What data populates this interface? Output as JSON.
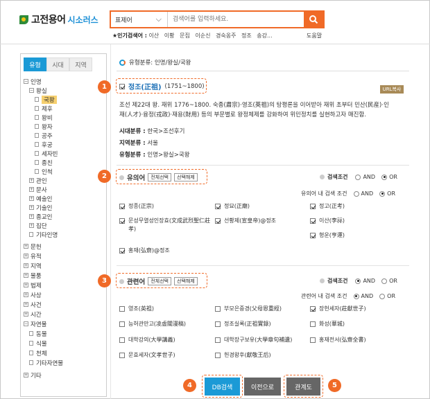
{
  "brand": {
    "name": "고전용어",
    "sub": "시소러스"
  },
  "search": {
    "select_value": "표제어",
    "placeholder": "검색어를 입력하세요."
  },
  "popular": {
    "label": "★인기검색어 :",
    "items": [
      "이산",
      "이황",
      "문집",
      "이순신",
      "경숙옹주",
      "정조",
      "송강..."
    ]
  },
  "help_label": "도움말",
  "left_tabs": [
    "유형",
    "시대",
    "지역"
  ],
  "tree": [
    {
      "label": "인명",
      "sign": "−"
    },
    {
      "label": "왕실",
      "sign": "−"
    },
    {
      "label": "국왕"
    },
    {
      "label": "제후"
    },
    {
      "label": "왕비"
    },
    {
      "label": "왕자"
    },
    {
      "label": "공주"
    },
    {
      "label": "후궁"
    },
    {
      "label": "세자빈"
    },
    {
      "label": "종친"
    },
    {
      "label": "인척"
    },
    {
      "label": "관인",
      "sign": "+"
    },
    {
      "label": "문사",
      "sign": "+"
    },
    {
      "label": "예술인",
      "sign": "+"
    },
    {
      "label": "기술인",
      "sign": "+"
    },
    {
      "label": "종교인",
      "sign": "+"
    },
    {
      "label": "집단",
      "sign": "+"
    },
    {
      "label": "기타인명"
    },
    {
      "label": "문헌",
      "sign": "+"
    },
    {
      "label": "유적",
      "sign": "+"
    },
    {
      "label": "지역",
      "sign": "+"
    },
    {
      "label": "물품",
      "sign": "+"
    },
    {
      "label": "법제",
      "sign": "+"
    },
    {
      "label": "사상",
      "sign": "+"
    },
    {
      "label": "사건",
      "sign": "+"
    },
    {
      "label": "시간",
      "sign": "+"
    },
    {
      "label": "자연물",
      "sign": "−"
    },
    {
      "label": "동물"
    },
    {
      "label": "식물"
    },
    {
      "label": "천체"
    },
    {
      "label": "기타자연물"
    },
    {
      "label": "기타",
      "sign": "+"
    }
  ],
  "breadcrumb": "유형분류: 인명/왕실/국왕",
  "entry": {
    "title": "정조(正祖)",
    "dates": "(1751~1800)",
    "url_button": "URL복사",
    "desc1": "조선 제22대 왕. 재위 1776~1800. 숙종(肅宗)·영조(英祖)의 탕평론을 이어받아 재위 초부터 민산(民産)·인",
    "desc2": "재(人才)·융정(戎政)·재용(財用) 등의 부문별로 왕정체제를 강화하여 위민정치를 실현하고자 매진함.",
    "era": "한국>조선후기",
    "region": "서울",
    "type": "인명>왕실>국왕",
    "era_label": "시대분류 :",
    "region_label": "지역분류 :",
    "type_label": "유형분류 :"
  },
  "synonyms": {
    "label": "유의어",
    "select_all": "전체선택",
    "deselect": "선택해제",
    "cond_label": "검색조건",
    "inner_cond_label": "유의어 내 검색 조건",
    "items": [
      "정종(正宗)",
      "정묘(正廟)",
      "정고(正考)",
      "문성무열성인장효(文成武烈聖仁莊孝)",
      "선황제(宣皇帝)@정조",
      "이산(李祘)",
      "형운(亨運)",
      "홍재(弘齋)@정조"
    ]
  },
  "related": {
    "label": "관련어",
    "select_all": "전체선택",
    "deselect": "선택해제",
    "cond_label": "검색조건",
    "inner_cond_label": "관련어 내 검색 조건",
    "items": [
      "영조(英祖)",
      "부모은중경(父母恩重經)",
      "장헌세자(莊獻世子)",
      "능허관만고(凌虛關漫稿)",
      "정조실록(正祖實錄)",
      "화성(華城)",
      "대학강의(大學講義)",
      "대학장구보유(大學章句補遺)",
      "홍재전서(弘齋全書)",
      "문효세자(文孝世子)",
      "헌경왕후(獻敬王后)"
    ]
  },
  "and_label": "AND",
  "or_label": "OR",
  "buttons": {
    "db_search": "DB검색",
    "back": "이전으로",
    "graph": "관계도"
  },
  "markers": [
    "1",
    "2",
    "3",
    "4",
    "5"
  ],
  "colors": {
    "accent": "#f06a27",
    "blue": "#1b9ad6",
    "gray_button": "#666666"
  }
}
